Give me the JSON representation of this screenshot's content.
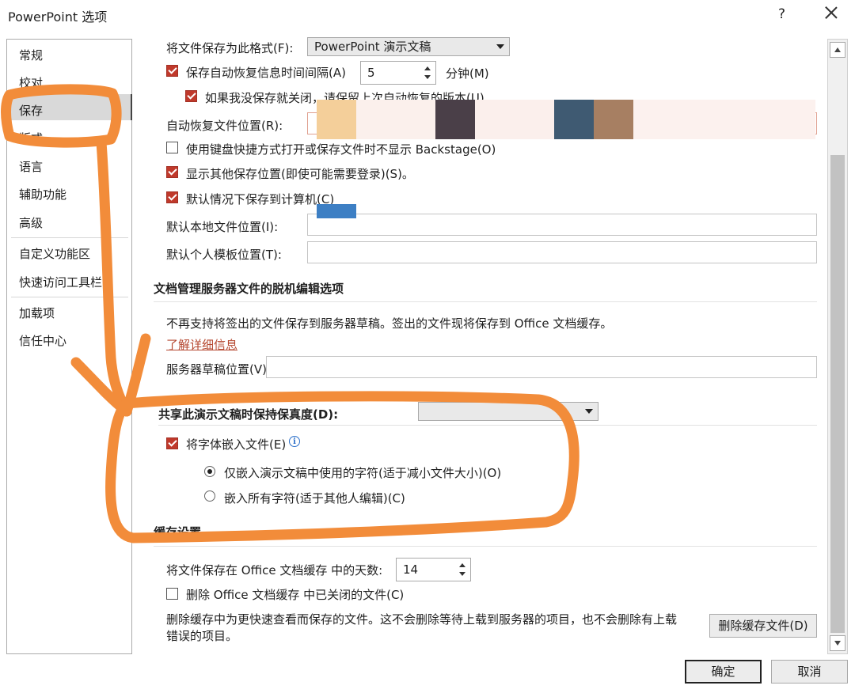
{
  "window": {
    "title": "PowerPoint 选项",
    "help": "?",
    "close_icon": "close-icon"
  },
  "sidebar": {
    "items": [
      {
        "label": "常规"
      },
      {
        "label": "校对"
      },
      {
        "label": "保存",
        "selected": true
      },
      {
        "label": "版式"
      },
      {
        "label": "语言"
      },
      {
        "label": "辅助功能"
      },
      {
        "label": "高级"
      },
      {
        "label": "自定义功能区"
      },
      {
        "label": "快速访问工具栏"
      },
      {
        "label": "加载项"
      },
      {
        "label": "信任中心"
      }
    ]
  },
  "save": {
    "format_label": "将文件保存为此格式(F):",
    "format_value": "PowerPoint 演示文稿",
    "autorecover_label": "保存自动恢复信息时间间隔(A)",
    "autorecover_checked": true,
    "autorecover_minutes": "5",
    "minutes_label": "分钟(M)",
    "keep_last_label": "如果我没保存就关闭，请保留上次自动恢复的版本(U)",
    "keep_last_checked": true,
    "autorecover_location_label": "自动恢复文件位置(R):",
    "keyboard_shortcut_label": "使用键盘快捷方式打开或保存文件时不显示 Backstage(O)",
    "keyboard_shortcut_checked": false,
    "show_additional_label": "显示其他保存位置(即使可能需要登录)(S)。",
    "show_additional_checked": true,
    "save_to_computer_label": "默认情况下保存到计算机(C)",
    "save_to_computer_checked": true,
    "default_local_label": "默认本地文件位置(I):",
    "default_template_label": "默认个人模板位置(T):"
  },
  "offline": {
    "heading": "文档管理服务器文件的脱机编辑选项",
    "description": "不再支持将签出的文件保存到服务器草稿。签出的文件现将保存到 Office 文档缓存。",
    "learn_more": "了解详细信息",
    "drafts_location_label": "服务器草稿位置(V):"
  },
  "fidelity": {
    "heading": "共享此演示文稿时保持保真度(D):",
    "embed_fonts_label": "将字体嵌入文件(E)",
    "embed_fonts_checked": true,
    "info_icon": "info-icon",
    "embed_used_label": "仅嵌入演示文稿中使用的字符(适于减小文件大小)(O)",
    "embed_used_selected": true,
    "embed_all_label": "嵌入所有字符(适于其他人编辑)(C)",
    "embed_all_selected": false
  },
  "cache": {
    "heading": "缓存设置",
    "days_label": "将文件保存在 Office 文档缓存 中的天数:",
    "days_value": "14",
    "delete_closed_label": "删除 Office 文档缓存 中已关闭的文件(C)",
    "delete_closed_checked": false,
    "note_line1": "删除缓存中为更快速查看而保存的文件。这不会删除等待上载到服务器的项目，也不会删除有上载",
    "note_line2": "错误的项目。",
    "delete_button": "删除缓存文件(D)"
  },
  "footer": {
    "ok": "确定",
    "cancel": "取消"
  },
  "annotation": {
    "color": "#f28c3a"
  }
}
